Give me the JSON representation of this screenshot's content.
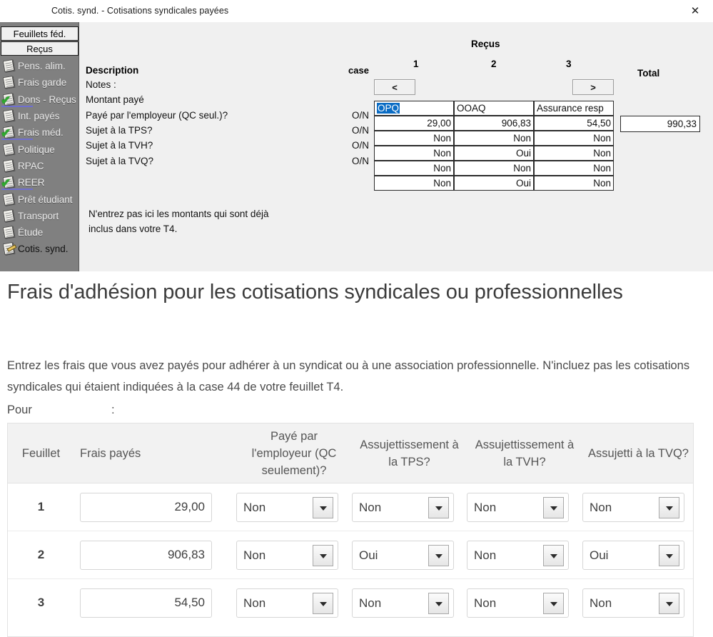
{
  "window": {
    "title": "Cotis. synd.  - Cotisations syndicales payées",
    "close_label": "✕"
  },
  "sidebar": {
    "tabs": [
      {
        "label": "Feuillets féd."
      },
      {
        "label": "Reçus"
      }
    ],
    "items": [
      {
        "label": "Pens. alim.",
        "icon": "page-icon",
        "checked": false,
        "active": false
      },
      {
        "label": "Frais garde",
        "icon": "page-icon",
        "checked": false,
        "active": false
      },
      {
        "label": "Dons - Reçus",
        "icon": "page-check-icon",
        "checked": true,
        "active": false
      },
      {
        "label": "Int. payés",
        "icon": "page-icon",
        "checked": false,
        "active": false
      },
      {
        "label": "Frais méd.",
        "icon": "page-check-icon",
        "checked": true,
        "active": false
      },
      {
        "label": "Politique",
        "icon": "page-icon",
        "checked": false,
        "active": false
      },
      {
        "label": "RPAC",
        "icon": "page-icon",
        "checked": false,
        "active": false
      },
      {
        "label": "REER",
        "icon": "page-check-icon",
        "checked": true,
        "active": false
      },
      {
        "label": "Prêt étudiant",
        "icon": "page-icon",
        "checked": false,
        "active": false
      },
      {
        "label": "Transport",
        "icon": "page-icon",
        "checked": false,
        "active": false
      },
      {
        "label": "Étude",
        "icon": "page-icon",
        "checked": false,
        "active": false
      },
      {
        "label": "Cotis. synd.",
        "icon": "page-pencil-icon",
        "checked": false,
        "active": true
      }
    ]
  },
  "legacy_grid": {
    "description_header": "Description",
    "case_header": "case",
    "recus_header": "Reçus",
    "total_header": "Total",
    "prev_label": "<",
    "next_label": ">",
    "column_numbers": [
      "1",
      "2",
      "3"
    ],
    "rows": [
      {
        "description": "Notes :",
        "case": "",
        "values": [
          "OPQ",
          "OOAQ",
          "Assurance resp "
        ],
        "selected_first": true
      },
      {
        "description": "Montant payé",
        "case": "",
        "values": [
          "29,00",
          "906,83",
          "54,50"
        ],
        "align": "right"
      },
      {
        "description": "Payé par l'employeur (QC seul.)?",
        "case": "O/N",
        "values": [
          "Non",
          "Non",
          "Non"
        ],
        "align": "right"
      },
      {
        "description": "Sujet à la TPS?",
        "case": "O/N",
        "values": [
          "Non",
          "Oui",
          "Non"
        ],
        "align": "right"
      },
      {
        "description": "Sujet à la TVH?",
        "case": "O/N",
        "values": [
          "Non",
          "Non",
          "Non"
        ],
        "align": "right"
      },
      {
        "description": "Sujet à la TVQ?",
        "case": "O/N",
        "values": [
          "Non",
          "Oui",
          "Non"
        ],
        "align": "right"
      }
    ],
    "total_value": "990,33",
    "note": "N'entrez pas ici les montants qui sont déjà inclus dans votre T4."
  },
  "main": {
    "heading": "Frais d'adhésion pour les cotisations syndicales ou professionnelles",
    "intro": "Entrez les frais que vous avez payés pour adhérer à un syndicat ou à une association professionnelle. N'incluez pas les cotisations syndicales qui étaient indiquées à la case 44 de votre feuillet T4.",
    "pour_label": "Pour",
    "pour_colon": ":",
    "pour_value": "",
    "table": {
      "headers": [
        "Feuillet",
        "Frais payés",
        "Payé par l'employeur (QC seulement)?",
        "Assujettissement à la TPS?",
        "Assujettissement à la TVH?",
        "Assujetti à la TVQ?"
      ],
      "rows": [
        {
          "feuillet": "1",
          "frais": "29,00",
          "employeur": "Non",
          "tps": "Non",
          "tvh": "Non",
          "tvq": "Non"
        },
        {
          "feuillet": "2",
          "frais": "906,83",
          "employeur": "Non",
          "tps": "Oui",
          "tvh": "Non",
          "tvq": "Oui"
        },
        {
          "feuillet": "3",
          "frais": "54,50",
          "employeur": "Non",
          "tps": "Non",
          "tvh": "Non",
          "tvq": "Non"
        }
      ],
      "amount_placeholder": "",
      "options": [
        "Non",
        "Oui"
      ]
    }
  },
  "colors": {
    "sidebar_bg": "#808080",
    "panel_bg": "#f0f0f0",
    "selection": "#0a6cc4",
    "check": "#2fa82f",
    "heading": "#3b3b3b",
    "body_text": "#4a4a4a",
    "table_header_bg": "#f2f2f2"
  }
}
